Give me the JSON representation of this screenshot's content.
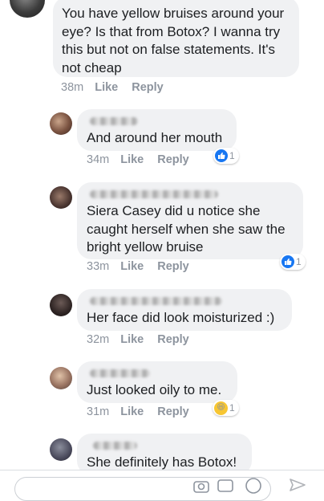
{
  "comments": [
    {
      "text": "You have yellow bruises around your eye? Is that from Botox? I wanna try this but not on false statements. It's not cheap",
      "time": "38m",
      "like": "Like",
      "reply": "Reply"
    },
    {
      "text": "And around her mouth",
      "time": "34m",
      "like": "Like",
      "reply": "Reply",
      "reaction": {
        "icon": "like-reaction-icon",
        "count": "1"
      }
    },
    {
      "text": "Siera Casey did u notice she caught herself when she saw the bright yellow bruise",
      "time": "33m",
      "like": "Like",
      "reply": "Reply",
      "reaction": {
        "icon": "like-reaction-icon",
        "count": "1"
      }
    },
    {
      "text": "Her face did look moisturized :)",
      "time": "32m",
      "like": "Like",
      "reply": "Reply"
    },
    {
      "text": "Just looked oily to me.",
      "time": "31m",
      "like": "Like",
      "reply": "Reply",
      "reaction": {
        "icon": "haha-reaction-icon",
        "count": "1"
      }
    },
    {
      "text": "She definitely has Botox!"
    }
  ],
  "colors": {
    "bubble": "#f0f1f3",
    "meta": "#8d949e",
    "like_blue": "#1877f2",
    "haha_yellow": "#f7c633"
  }
}
